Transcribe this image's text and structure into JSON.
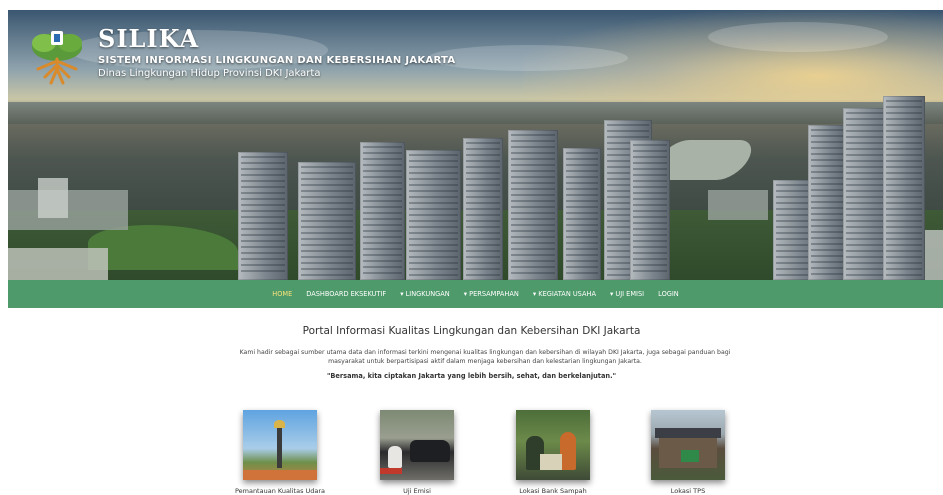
{
  "header": {
    "title": "SILIKA",
    "subtitle": "SISTEM INFORMASI LINGKUNGAN DAN KEBERSIHAN JAKARTA",
    "agency": "Dinas Lingkungan Hidup Provinsi DKI Jakarta",
    "logo_icon": "tree-with-roots-and-emblem-icon"
  },
  "nav": {
    "items": [
      {
        "label": "HOME"
      },
      {
        "label": "DASHBOARD EKSEKUTIF"
      },
      {
        "label": "▾ LINGKUNGAN"
      },
      {
        "label": "▾ PERSAMPAHAN"
      },
      {
        "label": "▾ KEGIATAN USAHA"
      },
      {
        "label": "▾ UJI EMISI"
      },
      {
        "label": "LOGIN"
      }
    ],
    "active_color": "#f6e27a",
    "bg_color": "#4e9a6b"
  },
  "main": {
    "title": "Portal Informasi Kualitas Lingkungan dan Kebersihan DKI Jakarta",
    "intro": "Kami hadir sebagai sumber utama data dan informasi terkini mengenai kualitas lingkungan dan kebersihan di wilayah DKI Jakarta, juga sebagai panduan bagi masyarakat untuk berpartisipasi aktif dalam menjaga kebersihan dan kelestarian lingkungan Jakarta.",
    "quote": "\"Bersama, kita ciptakan Jakarta yang lebih bersih, sehat, dan berkelanjutan.\""
  },
  "cards": [
    {
      "label": "Pemantauan Kualitas Udara"
    },
    {
      "label": "Uji Emisi"
    },
    {
      "label": "Lokasi Bank Sampah"
    },
    {
      "label": "Lokasi TPS"
    }
  ]
}
